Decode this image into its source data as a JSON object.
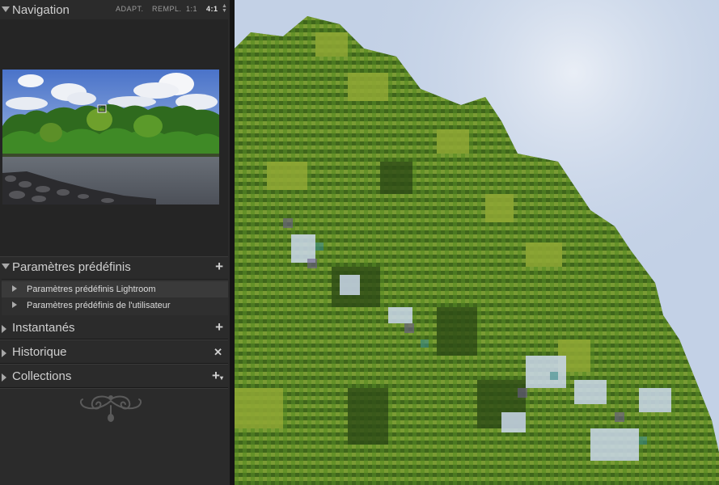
{
  "navigator": {
    "title": "Navigation",
    "zoom_options": [
      "ADAPT.",
      "REMPL.",
      "1:1",
      "4:1"
    ],
    "active_zoom": "4:1"
  },
  "presets": {
    "title": "Paramètres prédéfinis",
    "items": [
      {
        "label": "Paramètres prédéfinis Lightroom"
      },
      {
        "label": "Paramètres prédéfinis de l'utilisateur"
      }
    ]
  },
  "snapshots": {
    "title": "Instantanés"
  },
  "history": {
    "title": "Historique"
  },
  "collections": {
    "title": "Collections"
  },
  "colors": {
    "panel_bg": "#2b2b2b",
    "text": "#cfcfcf",
    "sky": "#c4d2e6",
    "foliage": "#4f7a1f"
  }
}
